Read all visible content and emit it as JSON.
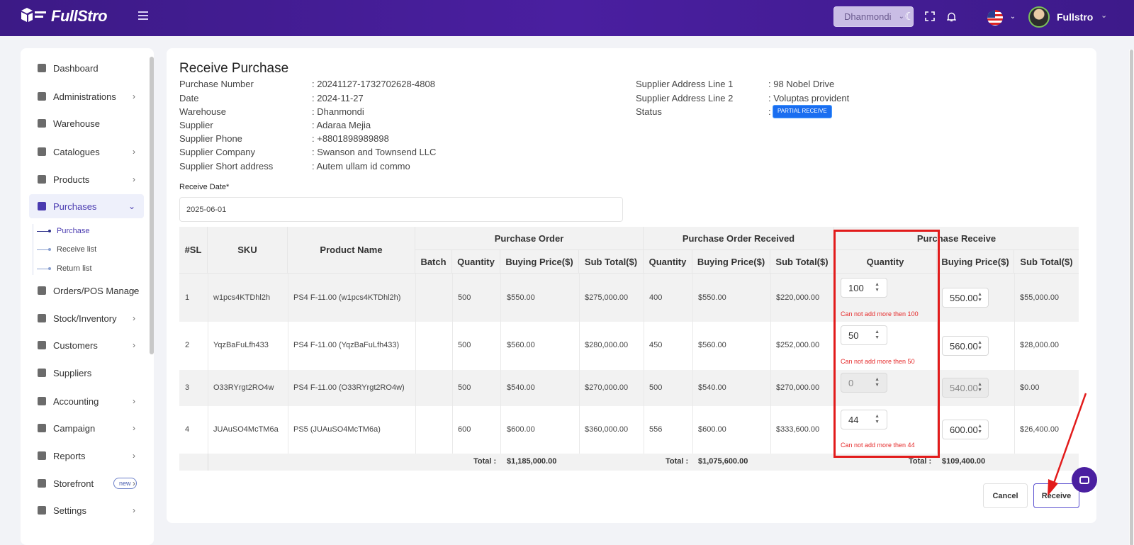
{
  "header": {
    "logo_text": "FullStro",
    "branch": "Dhanmondi",
    "username": "Fullstro"
  },
  "sidebar": {
    "items": [
      {
        "label": "Dashboard",
        "icon": "monitor-icon"
      },
      {
        "label": "Administrations",
        "icon": "user-icon"
      },
      {
        "label": "Warehouse",
        "icon": "warehouse-icon"
      },
      {
        "label": "Catalogues",
        "icon": "catalog-icon"
      },
      {
        "label": "Products",
        "icon": "products-icon"
      },
      {
        "label": "Purchases",
        "icon": "purchases-icon"
      },
      {
        "label": "Orders/POS Manage",
        "icon": "orders-icon"
      },
      {
        "label": "Stock/Inventory",
        "icon": "stock-icon"
      },
      {
        "label": "Customers",
        "icon": "customers-icon"
      },
      {
        "label": "Suppliers",
        "icon": "suppliers-icon"
      },
      {
        "label": "Accounting",
        "icon": "accounting-icon"
      },
      {
        "label": "Campaign",
        "icon": "campaign-icon"
      },
      {
        "label": "Reports",
        "icon": "reports-icon"
      },
      {
        "label": "Storefront",
        "icon": "storefront-icon",
        "badge": "new"
      },
      {
        "label": "Settings",
        "icon": "settings-icon"
      }
    ],
    "purchase_sub": [
      "Purchase",
      "Receive list",
      "Return list"
    ]
  },
  "page": {
    "title": "Receive Purchase",
    "left_info": [
      {
        "label": "Purchase Number",
        "value": ": 20241127-1732702628-4808"
      },
      {
        "label": "Date",
        "value": ": 2024-11-27"
      },
      {
        "label": "Warehouse",
        "value": ": Dhanmondi"
      },
      {
        "label": "Supplier",
        "value": ": Adaraa Mejia"
      },
      {
        "label": "Supplier Phone",
        "value": ": +8801898989898"
      },
      {
        "label": "Supplier Company",
        "value": ": Swanson and Townsend LLC"
      },
      {
        "label": "Supplier Short address",
        "value": ": Autem ullam id commo"
      }
    ],
    "right_info": [
      {
        "label": "Supplier Address Line 1",
        "value": ": 98 Nobel Drive"
      },
      {
        "label": "Supplier Address Line 2",
        "value": ": Voluptas provident"
      },
      {
        "label": "Status",
        "value": ":"
      }
    ],
    "status_badge": "PARTIAL RECEIVE",
    "receive_date_label": "Receive Date*",
    "receive_date_value": "2025-06-01"
  },
  "table": {
    "group_headers": [
      "Purchase Order",
      "Purchase Order Received",
      "Purchase Receive"
    ],
    "headers": {
      "sl": "#SL",
      "sku": "SKU",
      "product": "Product Name",
      "batch": "Batch",
      "quantity": "Quantity",
      "buying_price": "Buying Price($)",
      "sub_total": "Sub Total($)"
    },
    "rows": [
      {
        "sl": "1",
        "sku": "w1pcs4KTDhl2h",
        "product": "PS4 F-11.00 (w1pcs4KTDhl2h)",
        "po_qty": "500",
        "po_price": "$550.00",
        "po_sub": "$275,000.00",
        "r_qty": "400",
        "r_price": "$550.00",
        "r_sub": "$220,000.00",
        "rec_qty": "100",
        "rec_price": "550.00",
        "rec_sub": "$55,000.00",
        "error": "Can not add more then 100"
      },
      {
        "sl": "2",
        "sku": "YqzBaFuLfh433",
        "product": "PS4 F-11.00 (YqzBaFuLfh433)",
        "po_qty": "500",
        "po_price": "$560.00",
        "po_sub": "$280,000.00",
        "r_qty": "450",
        "r_price": "$560.00",
        "r_sub": "$252,000.00",
        "rec_qty": "50",
        "rec_price": "560.00",
        "rec_sub": "$28,000.00",
        "error": "Can not add more then 50"
      },
      {
        "sl": "3",
        "sku": "O33RYrgt2RO4w",
        "product": "PS4 F-11.00 (O33RYrgt2RO4w)",
        "po_qty": "500",
        "po_price": "$540.00",
        "po_sub": "$270,000.00",
        "r_qty": "500",
        "r_price": "$540.00",
        "r_sub": "$270,000.00",
        "rec_qty": "0",
        "rec_price": "540.00",
        "rec_sub": "$0.00",
        "error": ""
      },
      {
        "sl": "4",
        "sku": "JUAuSO4McTM6a",
        "product": "PS5 (JUAuSO4McTM6a)",
        "po_qty": "600",
        "po_price": "$600.00",
        "po_sub": "$360,000.00",
        "r_qty": "556",
        "r_price": "$600.00",
        "r_sub": "$333,600.00",
        "rec_qty": "44",
        "rec_price": "600.00",
        "rec_sub": "$26,400.00",
        "error": "Can not add more then 44"
      }
    ],
    "totals": {
      "label": "Total :",
      "po_total": "$1,185,000.00",
      "received_total": "$1,075,600.00",
      "receive_total": "$109,400.00"
    }
  },
  "buttons": {
    "cancel": "Cancel",
    "receive": "Receive"
  },
  "colors": {
    "header": "#4a1fa0",
    "accent": "#4a3bb0",
    "error": "#e52a2a",
    "badge": "#1a6ef0"
  }
}
